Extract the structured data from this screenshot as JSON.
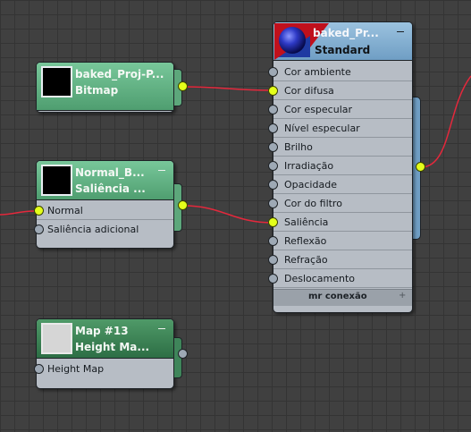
{
  "nodes": {
    "baked_bitmap": {
      "title_line1": "baked_Proj-P...",
      "title_line2": "Bitmap"
    },
    "normal_bump": {
      "title_line1": "Normal_B...",
      "title_line2": "Saliência ...",
      "slots": [
        "Normal",
        "Saliência adicional"
      ]
    },
    "map13": {
      "title_line1": "Map #13",
      "title_line2": "Height  Ma...",
      "slots": [
        "Height Map"
      ]
    },
    "material": {
      "title_line1": "baked_Pr...",
      "title_line2": "Standard",
      "slots": [
        "Cor ambiente",
        "Cor difusa",
        "Cor especular",
        "Nível especular",
        "Brilho",
        "Irradiação",
        "Opacidade",
        "Cor do filtro",
        "Saliência",
        "Reflexão",
        "Refração",
        "Deslocamento"
      ],
      "footer": "mr conexão"
    }
  },
  "colors": {
    "wire": "#e4283c",
    "socket_connected": "#e4ff1a",
    "socket_empty": "#9ea9b5"
  }
}
